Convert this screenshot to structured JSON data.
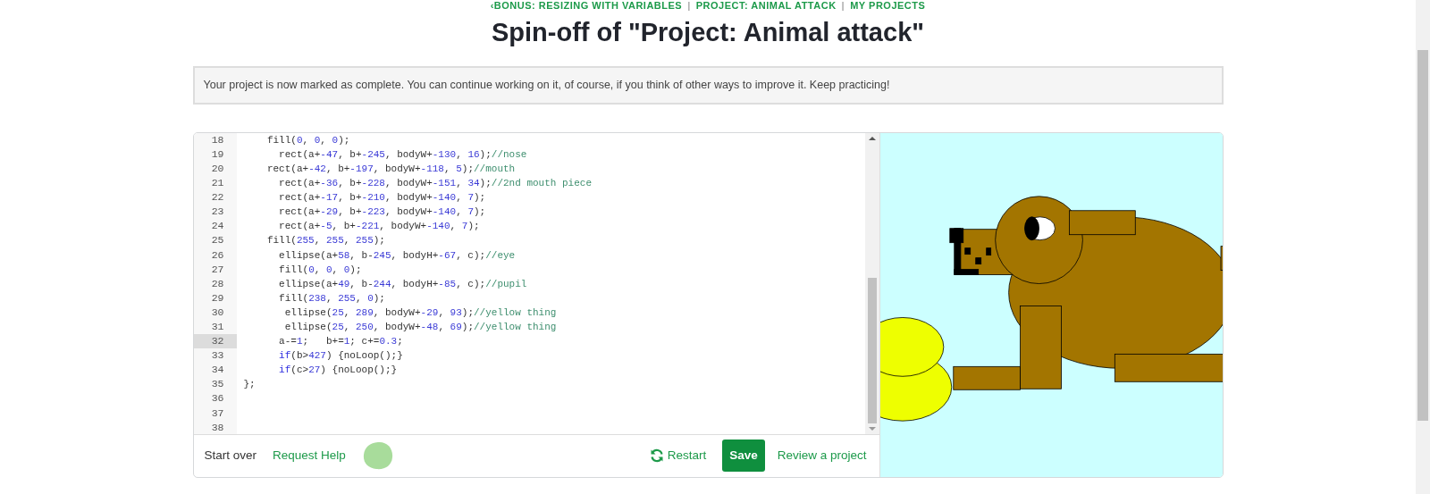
{
  "breadcrumbs": [
    {
      "kind": "link",
      "label": "‹BONUS: RESIZING WITH VARIABLES"
    },
    {
      "kind": "separator",
      "label": "|"
    },
    {
      "kind": "link",
      "label": "PROJECT: ANIMAL ATTACK"
    },
    {
      "kind": "separator",
      "label": "|"
    },
    {
      "kind": "link",
      "label": "MY PROJECTS"
    }
  ],
  "title": "Spin-off of \"Project: Animal attack\"",
  "notice": "Your project is now marked as complete. You can continue working on it, of course, if you think of other ways to improve it. Keep practicing!",
  "editor": {
    "lines": [
      {
        "number": "18",
        "active": false,
        "tokens": [
          {
            "kind": "plain",
            "text": "    fill("
          },
          {
            "kind": "number",
            "text": "0"
          },
          {
            "kind": "plain",
            "text": ", "
          },
          {
            "kind": "number",
            "text": "0"
          },
          {
            "kind": "plain",
            "text": ", "
          },
          {
            "kind": "number",
            "text": "0"
          },
          {
            "kind": "plain",
            "text": ");"
          }
        ]
      },
      {
        "number": "19",
        "active": false,
        "tokens": [
          {
            "kind": "plain",
            "text": "      rect(a+"
          },
          {
            "kind": "number",
            "text": "-47"
          },
          {
            "kind": "plain",
            "text": ", b+"
          },
          {
            "kind": "number",
            "text": "-245"
          },
          {
            "kind": "plain",
            "text": ", bodyW+"
          },
          {
            "kind": "number",
            "text": "-130"
          },
          {
            "kind": "plain",
            "text": ", "
          },
          {
            "kind": "number",
            "text": "16"
          },
          {
            "kind": "plain",
            "text": ");"
          },
          {
            "kind": "comment",
            "text": "//nose"
          }
        ]
      },
      {
        "number": "20",
        "active": false,
        "tokens": [
          {
            "kind": "plain",
            "text": "    rect(a+"
          },
          {
            "kind": "number",
            "text": "-42"
          },
          {
            "kind": "plain",
            "text": ", b+"
          },
          {
            "kind": "number",
            "text": "-197"
          },
          {
            "kind": "plain",
            "text": ", bodyW+"
          },
          {
            "kind": "number",
            "text": "-118"
          },
          {
            "kind": "plain",
            "text": ", "
          },
          {
            "kind": "number",
            "text": "5"
          },
          {
            "kind": "plain",
            "text": ");"
          },
          {
            "kind": "comment",
            "text": "//mouth"
          }
        ]
      },
      {
        "number": "21",
        "active": false,
        "tokens": [
          {
            "kind": "plain",
            "text": "      rect(a+"
          },
          {
            "kind": "number",
            "text": "-36"
          },
          {
            "kind": "plain",
            "text": ", b+"
          },
          {
            "kind": "number",
            "text": "-228"
          },
          {
            "kind": "plain",
            "text": ", bodyW+"
          },
          {
            "kind": "number",
            "text": "-151"
          },
          {
            "kind": "plain",
            "text": ", "
          },
          {
            "kind": "number",
            "text": "34"
          },
          {
            "kind": "plain",
            "text": ");"
          },
          {
            "kind": "comment",
            "text": "//2nd mouth piece"
          }
        ]
      },
      {
        "number": "22",
        "active": false,
        "tokens": [
          {
            "kind": "plain",
            "text": "      rect(a+"
          },
          {
            "kind": "number",
            "text": "-17"
          },
          {
            "kind": "plain",
            "text": ", b+"
          },
          {
            "kind": "number",
            "text": "-210"
          },
          {
            "kind": "plain",
            "text": ", bodyW+"
          },
          {
            "kind": "number",
            "text": "-140"
          },
          {
            "kind": "plain",
            "text": ", "
          },
          {
            "kind": "number",
            "text": "7"
          },
          {
            "kind": "plain",
            "text": ");"
          }
        ]
      },
      {
        "number": "23",
        "active": false,
        "tokens": [
          {
            "kind": "plain",
            "text": "      rect(a+"
          },
          {
            "kind": "number",
            "text": "-29"
          },
          {
            "kind": "plain",
            "text": ", b+"
          },
          {
            "kind": "number",
            "text": "-223"
          },
          {
            "kind": "plain",
            "text": ", bodyW+"
          },
          {
            "kind": "number",
            "text": "-140"
          },
          {
            "kind": "plain",
            "text": ", "
          },
          {
            "kind": "number",
            "text": "7"
          },
          {
            "kind": "plain",
            "text": ");"
          }
        ]
      },
      {
        "number": "24",
        "active": false,
        "tokens": [
          {
            "kind": "plain",
            "text": "      rect(a+"
          },
          {
            "kind": "number",
            "text": "-5"
          },
          {
            "kind": "plain",
            "text": ", b+"
          },
          {
            "kind": "number",
            "text": "-221"
          },
          {
            "kind": "plain",
            "text": ", bodyW+"
          },
          {
            "kind": "number",
            "text": "-140"
          },
          {
            "kind": "plain",
            "text": ", "
          },
          {
            "kind": "number",
            "text": "7"
          },
          {
            "kind": "plain",
            "text": ");"
          }
        ]
      },
      {
        "number": "25",
        "active": false,
        "tokens": [
          {
            "kind": "plain",
            "text": "    fill("
          },
          {
            "kind": "number",
            "text": "255"
          },
          {
            "kind": "plain",
            "text": ", "
          },
          {
            "kind": "number",
            "text": "255"
          },
          {
            "kind": "plain",
            "text": ", "
          },
          {
            "kind": "number",
            "text": "255"
          },
          {
            "kind": "plain",
            "text": ");"
          }
        ]
      },
      {
        "number": "26",
        "active": false,
        "tokens": [
          {
            "kind": "plain",
            "text": "      ellipse(a+"
          },
          {
            "kind": "number",
            "text": "58"
          },
          {
            "kind": "plain",
            "text": ", b-"
          },
          {
            "kind": "number",
            "text": "245"
          },
          {
            "kind": "plain",
            "text": ", bodyH+"
          },
          {
            "kind": "number",
            "text": "-67"
          },
          {
            "kind": "plain",
            "text": ", c);"
          },
          {
            "kind": "comment",
            "text": "//eye"
          }
        ]
      },
      {
        "number": "27",
        "active": false,
        "tokens": [
          {
            "kind": "plain",
            "text": "      fill("
          },
          {
            "kind": "number",
            "text": "0"
          },
          {
            "kind": "plain",
            "text": ", "
          },
          {
            "kind": "number",
            "text": "0"
          },
          {
            "kind": "plain",
            "text": ", "
          },
          {
            "kind": "number",
            "text": "0"
          },
          {
            "kind": "plain",
            "text": ");"
          }
        ]
      },
      {
        "number": "28",
        "active": false,
        "tokens": [
          {
            "kind": "plain",
            "text": "      ellipse(a+"
          },
          {
            "kind": "number",
            "text": "49"
          },
          {
            "kind": "plain",
            "text": ", b-"
          },
          {
            "kind": "number",
            "text": "244"
          },
          {
            "kind": "plain",
            "text": ", bodyH+"
          },
          {
            "kind": "number",
            "text": "-85"
          },
          {
            "kind": "plain",
            "text": ", c);"
          },
          {
            "kind": "comment",
            "text": "//pupil"
          }
        ]
      },
      {
        "number": "29",
        "active": false,
        "tokens": [
          {
            "kind": "plain",
            "text": "      fill("
          },
          {
            "kind": "number",
            "text": "238"
          },
          {
            "kind": "plain",
            "text": ", "
          },
          {
            "kind": "number",
            "text": "255"
          },
          {
            "kind": "plain",
            "text": ", "
          },
          {
            "kind": "number",
            "text": "0"
          },
          {
            "kind": "plain",
            "text": ");"
          }
        ]
      },
      {
        "number": "30",
        "active": false,
        "tokens": [
          {
            "kind": "plain",
            "text": "       ellipse("
          },
          {
            "kind": "number",
            "text": "25"
          },
          {
            "kind": "plain",
            "text": ", "
          },
          {
            "kind": "number",
            "text": "289"
          },
          {
            "kind": "plain",
            "text": ", bodyW+"
          },
          {
            "kind": "number",
            "text": "-29"
          },
          {
            "kind": "plain",
            "text": ", "
          },
          {
            "kind": "number",
            "text": "93"
          },
          {
            "kind": "plain",
            "text": ");"
          },
          {
            "kind": "comment",
            "text": "//yellow thing"
          }
        ]
      },
      {
        "number": "31",
        "active": false,
        "tokens": [
          {
            "kind": "plain",
            "text": "       ellipse("
          },
          {
            "kind": "number",
            "text": "25"
          },
          {
            "kind": "plain",
            "text": ", "
          },
          {
            "kind": "number",
            "text": "250"
          },
          {
            "kind": "plain",
            "text": ", bodyW+"
          },
          {
            "kind": "number",
            "text": "-48"
          },
          {
            "kind": "plain",
            "text": ", "
          },
          {
            "kind": "number",
            "text": "69"
          },
          {
            "kind": "plain",
            "text": ");"
          },
          {
            "kind": "comment",
            "text": "//yellow thing"
          }
        ]
      },
      {
        "number": "32",
        "active": true,
        "tokens": [
          {
            "kind": "plain",
            "text": "      a-="
          },
          {
            "kind": "number",
            "text": "1"
          },
          {
            "kind": "plain",
            "text": ";   b+="
          },
          {
            "kind": "number",
            "text": "1"
          },
          {
            "kind": "plain",
            "text": "; c+="
          },
          {
            "kind": "number",
            "text": "0.3"
          },
          {
            "kind": "plain",
            "text": ";"
          }
        ]
      },
      {
        "number": "33",
        "active": false,
        "tokens": [
          {
            "kind": "keyword",
            "text": "      if"
          },
          {
            "kind": "plain",
            "text": "(b>"
          },
          {
            "kind": "number",
            "text": "427"
          },
          {
            "kind": "plain",
            "text": ") {noLoop();}"
          }
        ]
      },
      {
        "number": "34",
        "active": false,
        "tokens": [
          {
            "kind": "keyword",
            "text": "      if"
          },
          {
            "kind": "plain",
            "text": "(c>"
          },
          {
            "kind": "number",
            "text": "27"
          },
          {
            "kind": "plain",
            "text": ") {noLoop();}"
          }
        ]
      },
      {
        "number": "35",
        "active": false,
        "tokens": [
          {
            "kind": "plain",
            "text": "};"
          }
        ]
      },
      {
        "number": "36",
        "active": false
      },
      {
        "number": "37",
        "active": false
      },
      {
        "number": "38",
        "active": false
      }
    ]
  },
  "footer": {
    "start_over": "Start over",
    "request_help": "Request Help",
    "restart": "Restart",
    "save": "Save",
    "review": "Review a project"
  }
}
